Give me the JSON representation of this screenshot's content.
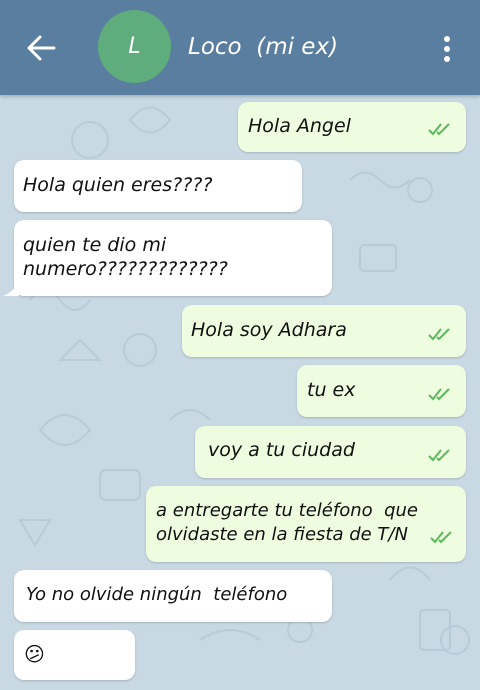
{
  "header": {
    "avatar_letter": "L",
    "title": "Loco  (mi ex)"
  },
  "messages": [
    {
      "text": "Hola Angel"
    },
    {
      "text": "Hola quien eres????"
    },
    {
      "text": "quien te dio mi\nnumero?????????????"
    },
    {
      "text": "Hola soy Adhara"
    },
    {
      "text": "tu ex"
    },
    {
      "text": "voy a tu ciudad"
    },
    {
      "text": "a entregarte tu teléfono  que\nolvidaste en la fiesta de T/N"
    },
    {
      "text": "Yo no olvide ningún  teléfono"
    },
    {
      "text": "😕"
    }
  ],
  "colors": {
    "header": "#5a7e9f",
    "background": "#c9d9e4",
    "outgoing": "#eefcdf",
    "incoming": "#ffffff",
    "avatar": "#5fad7c",
    "read_ticks": "#5cb85c"
  }
}
